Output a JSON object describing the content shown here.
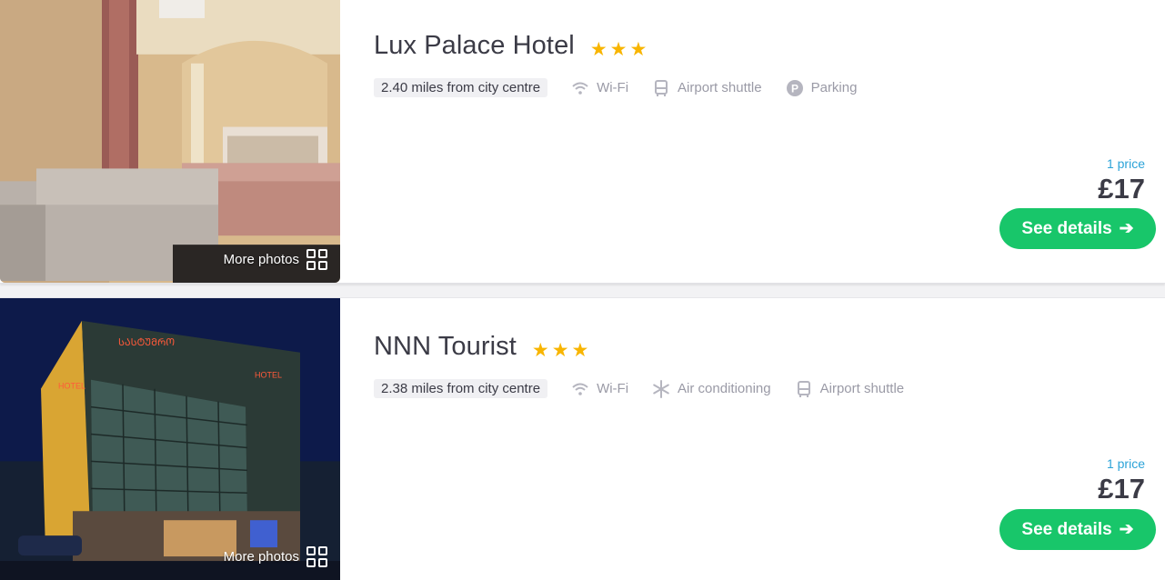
{
  "hotels": [
    {
      "name": "Lux Palace Hotel",
      "stars": 3,
      "distance": "2.40 miles from city centre",
      "amenities": [
        {
          "icon": "wifi-icon",
          "label": "Wi-Fi"
        },
        {
          "icon": "bus-icon",
          "label": "Airport shuttle"
        },
        {
          "icon": "parking-icon",
          "label": "Parking"
        }
      ],
      "price_count": "1 price",
      "price": "£17",
      "details_label": "See details",
      "more_photos_label": "More photos"
    },
    {
      "name": "NNN Tourist",
      "stars": 3,
      "distance": "2.38 miles from city centre",
      "amenities": [
        {
          "icon": "wifi-icon",
          "label": "Wi-Fi"
        },
        {
          "icon": "snowflake-icon",
          "label": "Air conditioning"
        },
        {
          "icon": "bus-icon",
          "label": "Airport shuttle"
        }
      ],
      "price_count": "1 price",
      "price": "£17",
      "details_label": "See details",
      "more_photos_label": "More photos"
    }
  ],
  "colors": {
    "star": "#f8b500",
    "cta": "#18c66a",
    "price_count": "#2ba3d8",
    "text": "#3b3b46",
    "muted": "#9a9aa6"
  }
}
